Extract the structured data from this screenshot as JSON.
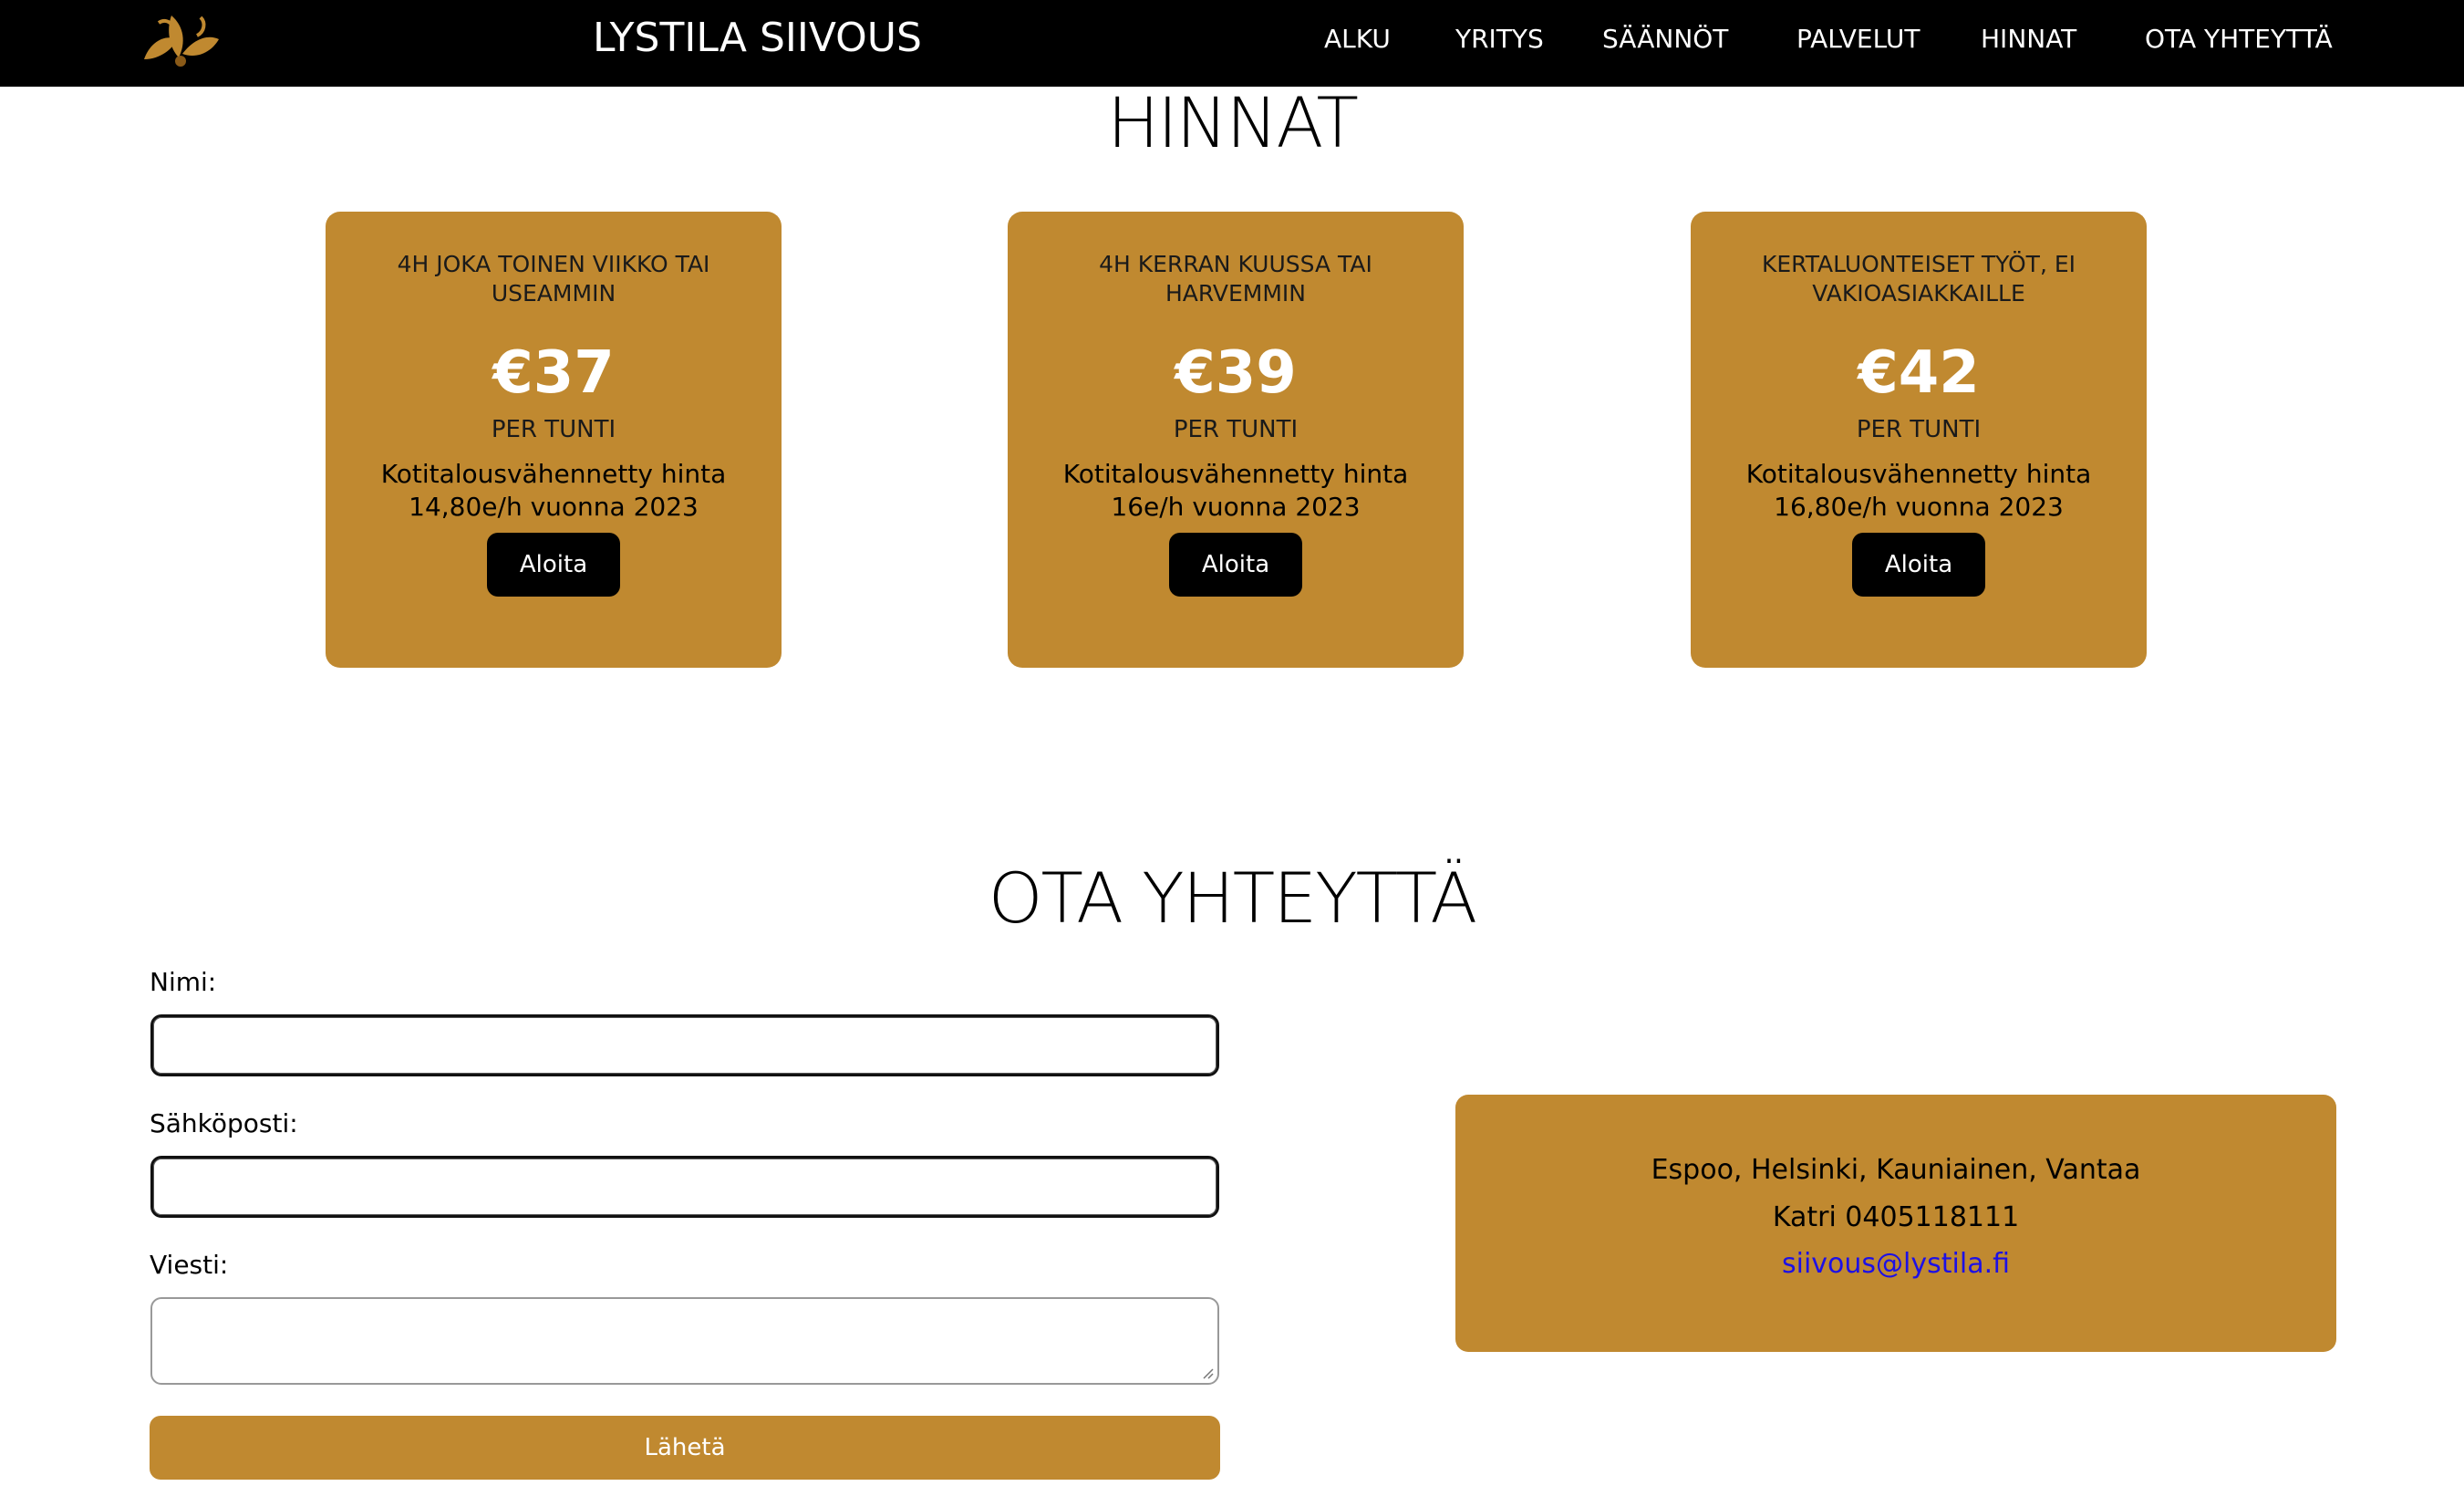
{
  "brand": {
    "name": "LYSTILA SIIVOUS",
    "logo_icon": "leaf-ornament-icon",
    "logo_color": "#c08930"
  },
  "nav": {
    "items": [
      {
        "label": "ALKU"
      },
      {
        "label": "YRITYS"
      },
      {
        "label": "SÄÄNNÖT"
      },
      {
        "label": "PALVELUT"
      },
      {
        "label": "HINNAT"
      },
      {
        "label": "OTA YHTEYTTÄ"
      }
    ]
  },
  "pricing": {
    "title": "HINNAT",
    "cards": [
      {
        "desc": "4H JOKA TOINEN VIIKKO TAI USEAMMIN",
        "price": "€37",
        "unit": "PER TUNTI",
        "note": "Kotitalousvähennetty hinta 14,80e/h vuonna 2023",
        "button": "Aloita"
      },
      {
        "desc": "4H KERRAN KUUSSA TAI HARVEMMIN",
        "price": "€39",
        "unit": "PER TUNTI",
        "note": "Kotitalousvähennetty hinta 16e/h vuonna 2023",
        "button": "Aloita"
      },
      {
        "desc": "KERTALUONTEISET TYÖT, EI VAKIOASIAKKAILLE",
        "price": "€42",
        "unit": "PER TUNTI",
        "note": "Kotitalousvähennetty hinta 16,80e/h vuonna 2023",
        "button": "Aloita"
      }
    ]
  },
  "contact": {
    "title": "OTA YHTEYTTÄ",
    "form": {
      "name_label": "Nimi:",
      "name_value": "",
      "email_label": "Sähköposti:",
      "email_value": "",
      "message_label": "Viesti:",
      "message_value": "",
      "submit_label": "Lähetä"
    },
    "info": {
      "areas": "Espoo, Helsinki, Kauniainen, Vantaa",
      "phone": "Katri 0405118111",
      "email": "siivous@lystila.fi"
    }
  },
  "colors": {
    "accent": "#c08930",
    "nav_bg": "#000000",
    "link": "#1d10e6"
  }
}
